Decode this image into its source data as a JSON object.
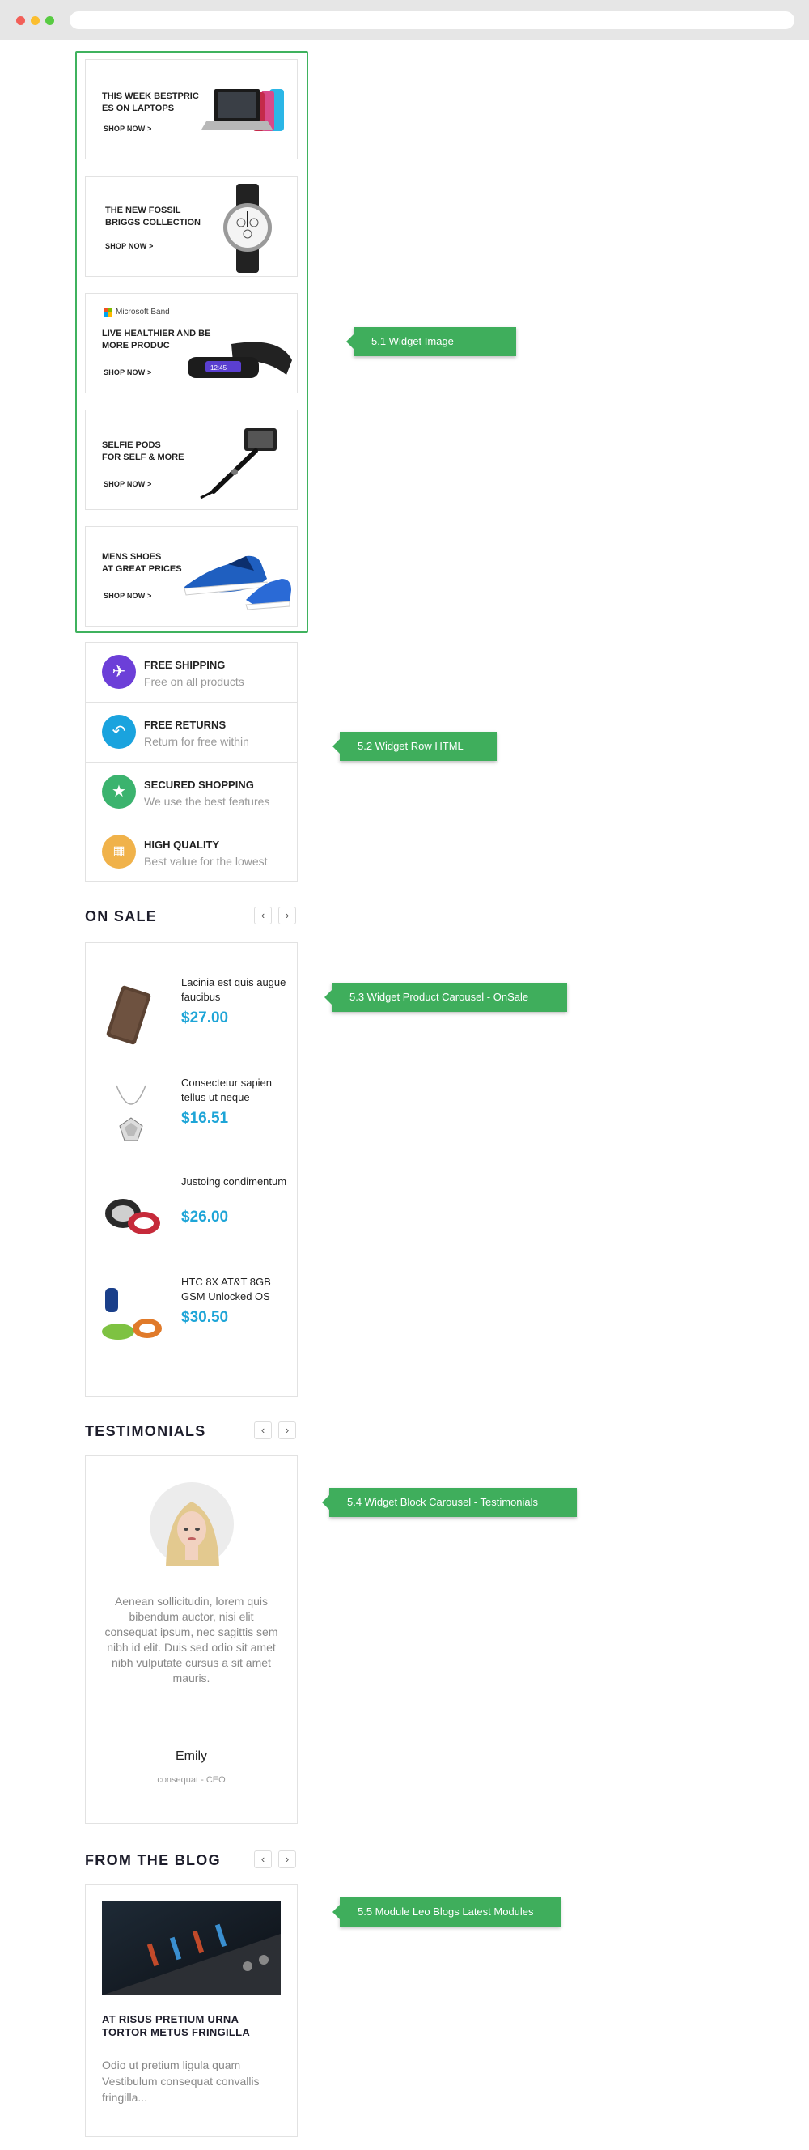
{
  "banners": [
    {
      "title": "THIS WEEK BESTPRIC\nES ON LAPTOPS",
      "shop": "SHOP NOW >",
      "image": "laptop-image"
    },
    {
      "title": "THE NEW FOSSIL\nBRIGGS COLLECTION",
      "shop": "SHOP NOW >",
      "image": "watch-image"
    },
    {
      "brand": "Microsoft Band",
      "title": "LIVE HEALTHIER AND BE\nMORE PRODUC",
      "shop": "SHOP NOW >",
      "image": "band-image"
    },
    {
      "title": "SELFIE PODS\nFOR SELF & MORE",
      "shop": "SHOP NOW >",
      "image": "selfie-stick-image"
    },
    {
      "title": "MENS SHOES\nAT GREAT PRICES",
      "shop": "SHOP NOW >",
      "image": "shoes-image"
    }
  ],
  "annotations": {
    "widget_image": "5.1 Widget Image",
    "widget_row_html": "5.2 Widget Row HTML",
    "product_carousel": "5.3 Widget Product Carousel - OnSale",
    "block_carousel": "5.4 Widget Block Carousel - Testimonials",
    "leo_blogs": "5.5 Module Leo Blogs Latest Modules"
  },
  "features": [
    {
      "title": "FREE SHIPPING",
      "subtitle": "Free on all products",
      "icon": "plane-icon",
      "color": "#6c3fd8"
    },
    {
      "title": "FREE RETURNS",
      "subtitle": "Return for free within",
      "icon": "return-arrow-icon",
      "color": "#1aa3de"
    },
    {
      "title": "SECURED SHOPPING",
      "subtitle": "We use the best features",
      "icon": "star-icon",
      "color": "#3bb36e"
    },
    {
      "title": "HIGH QUALITY",
      "subtitle": "Best value for the lowest",
      "icon": "quality-icon",
      "color": "#f0b24a"
    }
  ],
  "on_sale": {
    "title": "ON SALE",
    "prev": "‹",
    "next": "›",
    "products": [
      {
        "name": "Lacinia est quis augue faucibus",
        "price": "$27.00",
        "image": "leather-case-image"
      },
      {
        "name": "Consectetur sapien tellus ut neque",
        "price": "$16.51",
        "image": "necklace-image"
      },
      {
        "name": "Justoing condimentum",
        "price": "$26.00",
        "image": "bracelet-image"
      },
      {
        "name": "HTC 8X AT&T 8GB GSM Unlocked OS",
        "price": "$30.50",
        "image": "fitness-band-image"
      }
    ]
  },
  "testimonials": {
    "title": "TESTIMONIALS",
    "prev": "‹",
    "next": "›",
    "quote": "Aenean sollicitudin, lorem quis bibendum auctor, nisi elit consequat ipsum, nec sagittis sem nibh id elit. Duis sed odio sit amet nibh vulputate cursus a sit amet mauris.",
    "name": "Emily",
    "role": "consequat - CEO"
  },
  "blog": {
    "title": "FROM THE BLOG",
    "prev": "‹",
    "next": "›",
    "post_title": "AT RISUS PRETIUM URNA TORTOR METUS FRINGILLA",
    "excerpt": "Odio ut pretium ligula quam Vestibulum consequat convallis fringilla..."
  },
  "colors": {
    "accent_green": "#3fae5c",
    "price_blue": "#1ea5d7"
  }
}
